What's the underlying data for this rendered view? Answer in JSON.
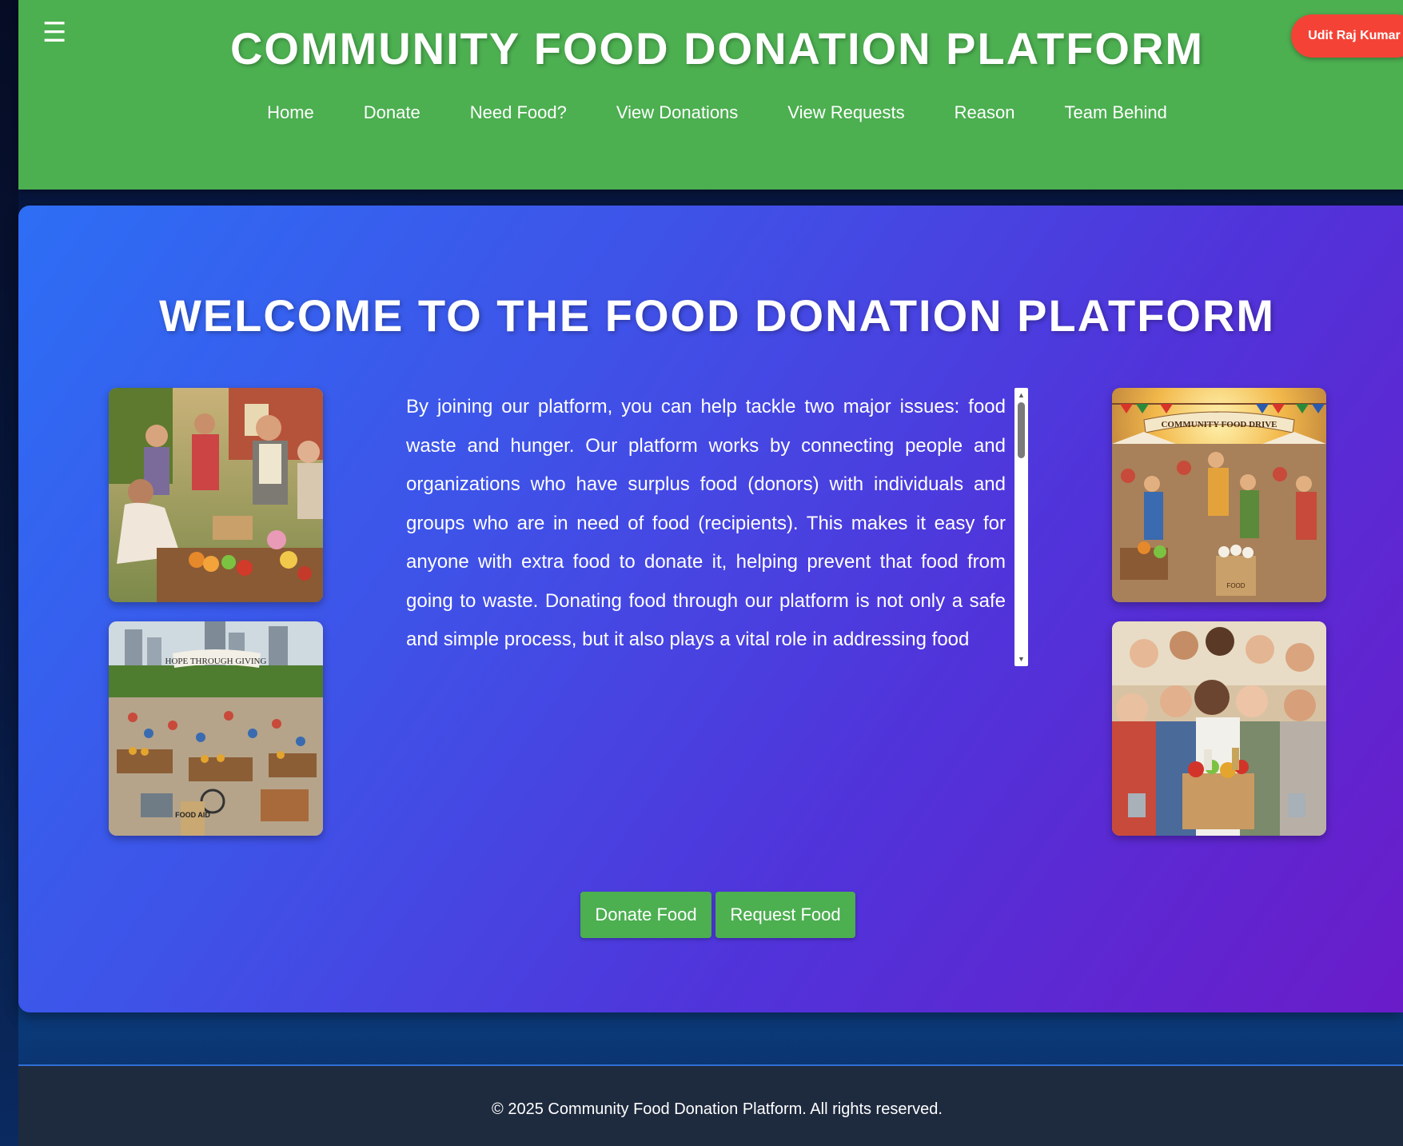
{
  "header": {
    "title": "COMMUNITY FOOD DONATION PLATFORM",
    "menu_icon": "☰",
    "user_name": "Udit Raj Kumar",
    "nav": [
      {
        "label": "Home"
      },
      {
        "label": "Donate"
      },
      {
        "label": "Need Food?"
      },
      {
        "label": "View Donations"
      },
      {
        "label": "View Requests"
      },
      {
        "label": "Reason"
      },
      {
        "label": "Team Behind"
      }
    ]
  },
  "hero": {
    "title": "WELCOME TO THE FOOD DONATION PLATFORM",
    "description": "By joining our platform, you can help tackle two major issues: food waste and hunger. Our platform works by connecting people and organizations who have surplus food (donors) with individuals and groups who are in need of food (recipients). This makes it easy for anyone with extra food to donate it, helping prevent that food from going to waste. Donating food through our platform is not only a safe and simple process, but it also plays a vital role in addressing food",
    "images": [
      {
        "id": "volunteers-sharing-food"
      },
      {
        "id": "hope-through-giving-market",
        "banner": "HOPE THROUGH GIVING",
        "sign": "FOOD AID"
      },
      {
        "id": "community-food-drive",
        "banner": "COMMUNITY FOOD DRIVE",
        "sign": "FOOD"
      },
      {
        "id": "happy-group-with-food-box"
      }
    ],
    "buttons": {
      "donate": "Donate Food",
      "request": "Request Food"
    }
  },
  "footer": {
    "text": "© 2025 Community Food Donation Platform. All rights reserved."
  },
  "colors": {
    "header_green": "#4caf50",
    "user_badge_red": "#f44336",
    "button_green": "#4caf50",
    "hero_gradient_start": "#2d6ef5",
    "hero_gradient_end": "#6a1cc9",
    "footer_bg": "#1e2a3e"
  },
  "icons": {
    "menu": "hamburger-menu-icon",
    "scroll_up": "▲",
    "scroll_down": "▼"
  }
}
